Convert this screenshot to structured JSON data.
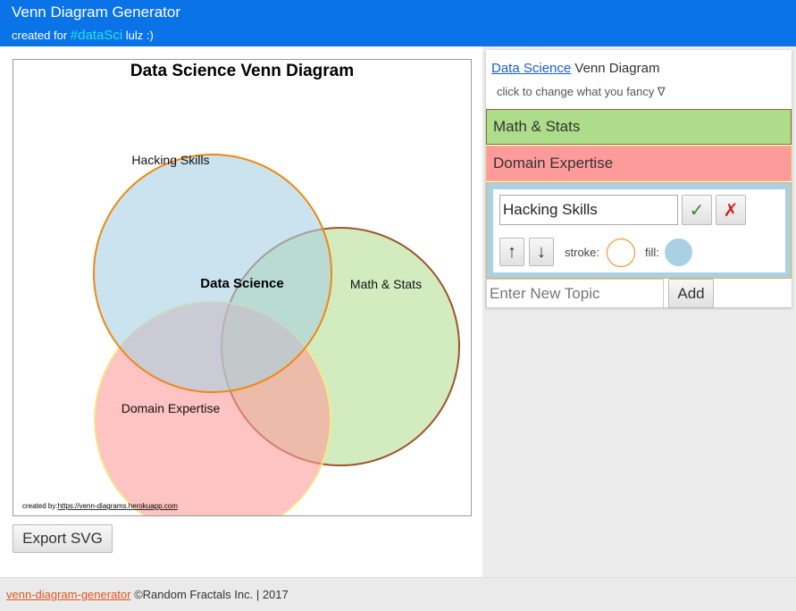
{
  "header": {
    "title": "Venn Diagram Generator",
    "subtitle_prefix": "created for",
    "hashtag": "#dataSci",
    "subtitle_suffix": "lulz :)"
  },
  "diagram": {
    "title": "Data Science Venn Diagram",
    "center_label": "Data Science",
    "credit_prefix": "created by:",
    "credit_link": "https://venn-diagrams.herokuapp.com",
    "circles": [
      {
        "name": "Hacking Skills",
        "fill": "#a9d1e3",
        "stroke": "#f0880f"
      },
      {
        "name": "Math & Stats",
        "fill": "#addc8a",
        "stroke": "#a0522d"
      },
      {
        "name": "Domain Expertise",
        "fill": "#fd9b9b",
        "stroke": "#f5e88a"
      }
    ]
  },
  "export_label": "Export SVG",
  "panel": {
    "link_text": "Data Science",
    "heading_suffix": "Venn Diagram",
    "hint": "click to change what you fancy ∇",
    "topics": [
      {
        "label": "Math & Stats"
      },
      {
        "label": "Domain Expertise"
      }
    ],
    "editor": {
      "name_value": "Hacking Skills",
      "ok_icon": "✓",
      "cancel_icon": "✗",
      "up_icon": "↑",
      "down_icon": "↓",
      "stroke_label": "stroke:",
      "fill_label": "fill:",
      "stroke_color": "#f0880f",
      "fill_color": "#a9d1e3"
    },
    "new_topic_placeholder": "Enter New Topic",
    "add_label": "Add"
  },
  "footer": {
    "link": "venn-diagram-generator",
    "text": "©Random Fractals Inc. | 2017"
  }
}
